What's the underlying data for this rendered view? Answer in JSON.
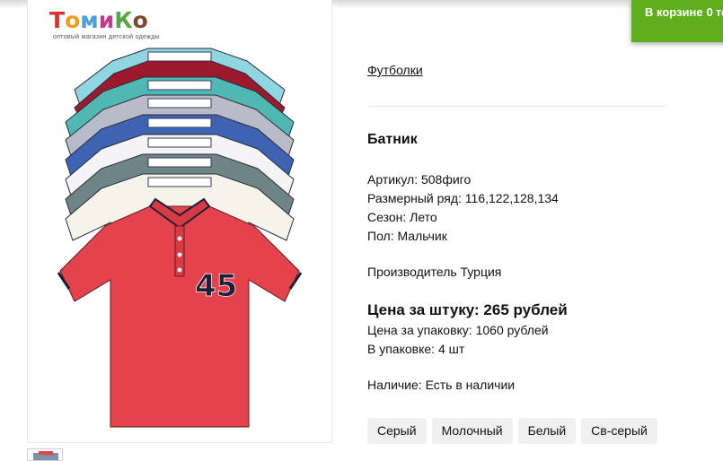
{
  "cart": {
    "label": "В корзине",
    "count": "0",
    "rest": "то"
  },
  "logo": {
    "letters": [
      "Т",
      "о",
      "м",
      "и",
      "К",
      "о"
    ],
    "tagline": "оптовый магазин детской одежды"
  },
  "breadcrumb": {
    "category": "Футболки"
  },
  "product": {
    "title": "Батник",
    "attributes": [
      "Артикул: 508фиго",
      "Размерный ряд: 116,122,128,134",
      "Сезон: Лето",
      "Пол: Мальчик"
    ],
    "manufacturer": "Производитель Турция",
    "price_per_item": "Цена за штуку: 265 рублей",
    "pack_price": "Цена за упаковку: 1060 рублей",
    "pack_quantity": "В упаковке: 4 шт",
    "availability": "Наличие: Есть в наличии",
    "image_print": "45"
  },
  "colors": [
    "Серый",
    "Молочный",
    "Белый",
    "Св-серый"
  ],
  "palette": {
    "cart_green": "#5fae1c",
    "shirt_front": "#e4434b",
    "chip_bg": "#f0f0f0"
  }
}
